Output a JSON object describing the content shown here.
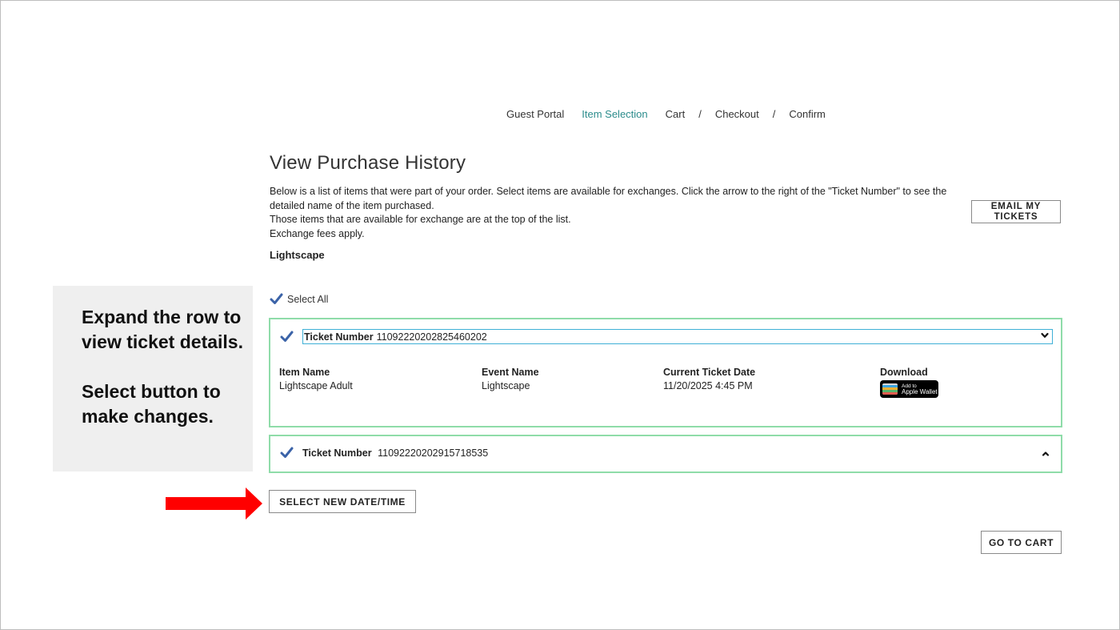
{
  "breadcrumb": {
    "guest_portal": "Guest Portal",
    "item_selection": "Item Selection",
    "cart": "Cart",
    "checkout": "Checkout",
    "confirm": "Confirm",
    "separator": "/"
  },
  "page": {
    "title": "View Purchase History",
    "intro_line1": "Below is a list of items that were part of your order.   Select items are available for exchanges.  Click the arrow to the right of the \"Ticket Number\" to see the detailed name of the item purchased.",
    "intro_line2": "Those items that are available for exchange are at the top of the list.",
    "intro_line3": "Exchange fees apply.",
    "event_name": "Lightscape",
    "email_button": "EMAIL MY TICKETS"
  },
  "callout": {
    "line1": "Expand the row to view ticket details.",
    "line2": "Select button to make changes."
  },
  "select_all": {
    "label": "Select All",
    "checked": true
  },
  "tickets": [
    {
      "label": "Ticket Number",
      "number": "11092220202825460202",
      "checked": true,
      "expanded": true,
      "columns": {
        "item_name_header": "Item Name",
        "item_name": "Lightscape Adult",
        "event_name_header": "Event Name",
        "event_name": "Lightscape",
        "date_header": "Current Ticket Date",
        "date": "11/20/2025 4:45 PM",
        "download_header": "Download"
      },
      "wallet_small": "Add to",
      "wallet_big": "Apple Wallet"
    },
    {
      "label": "Ticket Number",
      "number": "11092220202915718535",
      "checked": true,
      "expanded": false
    }
  ],
  "buttons": {
    "select_new_date": "SELECT NEW DATE/TIME",
    "go_to_cart": "GO TO CART"
  },
  "colors": {
    "accent_link": "#2b8c8c",
    "ticket_border": "#8fdca9",
    "select_border": "#3fb0d6",
    "checkmark": "#3b63a8",
    "arrow": "#ff0000",
    "callout_bg": "#efefef"
  },
  "icons": {
    "checkbox": "checkmark-icon",
    "expand": "chevron-down-icon",
    "collapse": "chevron-up-icon",
    "wallet": "apple-wallet-icon",
    "pointer": "red-arrow-icon"
  }
}
